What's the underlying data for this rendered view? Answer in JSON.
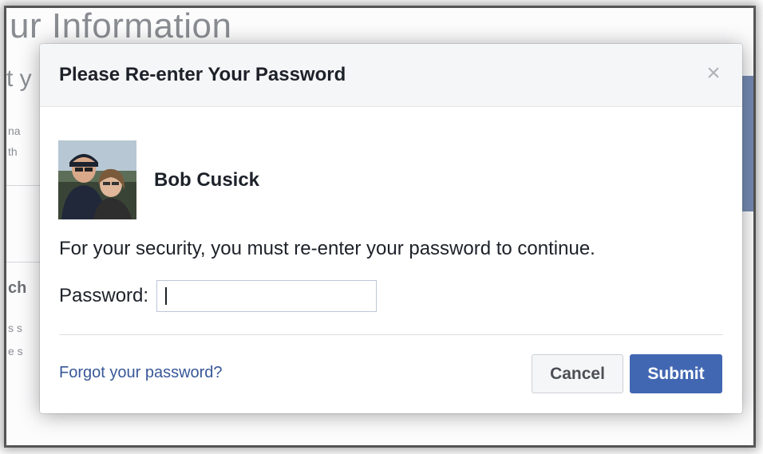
{
  "background": {
    "title": "ur Information",
    "subtitle": "t y",
    "line1": "na",
    "line2": "th",
    "section_heading": "ch",
    "line3": "s s",
    "line4": "e s"
  },
  "dialog": {
    "title": "Please Re-enter Your Password",
    "close_glyph": "×",
    "user": {
      "name": "Bob Cusick"
    },
    "message": "For your security, you must re-enter your password to continue.",
    "password": {
      "label": "Password:",
      "value": "",
      "placeholder": ""
    },
    "forgot_link": "Forgot your password?",
    "buttons": {
      "cancel": "Cancel",
      "submit": "Submit"
    }
  },
  "colors": {
    "primary": "#4267b2",
    "link": "#385898",
    "header_bg": "#f5f6f7",
    "text": "#1d2129"
  },
  "icons": {
    "close": "close-icon",
    "avatar": "user-avatar-photo"
  }
}
